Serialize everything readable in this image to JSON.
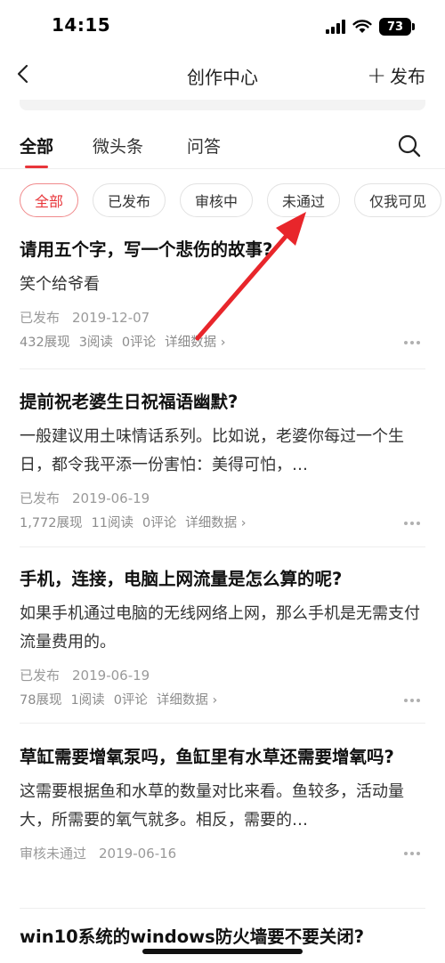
{
  "status_bar": {
    "time": "14:15",
    "battery": "73"
  },
  "nav": {
    "title": "创作中心",
    "publish_label": "发布"
  },
  "tabs": [
    {
      "label": "全部",
      "active": true
    },
    {
      "label": "微头条",
      "active": false
    },
    {
      "label": "问答",
      "active": false
    }
  ],
  "filters": [
    {
      "label": "全部",
      "active": true
    },
    {
      "label": "已发布",
      "active": false
    },
    {
      "label": "审核中",
      "active": false
    },
    {
      "label": "未通过",
      "active": false
    },
    {
      "label": "仅我可见",
      "active": false
    }
  ],
  "articles": [
    {
      "title": "请用五个字，写一个悲伤的故事?",
      "excerpt": "笑个给爷看",
      "status": "已发布",
      "date": "2019-12-07",
      "views": "432展现",
      "reads": "3阅读",
      "comments": "0评论",
      "detail": "详细数据 ›"
    },
    {
      "title": "提前祝老婆生日祝福语幽默?",
      "excerpt": "一般建议用土味情话系列。比如说，老婆你每过一个生日，都令我平添一份害怕：美得可怕，…",
      "status": "已发布",
      "date": "2019-06-19",
      "views": "1,772展现",
      "reads": "11阅读",
      "comments": "0评论",
      "detail": "详细数据 ›"
    },
    {
      "title": "手机，连接，电脑上网流量是怎么算的呢?",
      "excerpt": "如果手机通过电脑的无线网络上网，那么手机是无需支付流量费用的。",
      "status": "已发布",
      "date": "2019-06-19",
      "views": "78展现",
      "reads": "1阅读",
      "comments": "0评论",
      "detail": "详细数据 ›"
    },
    {
      "title": "草缸需要增氧泵吗，鱼缸里有水草还需要增氧吗?",
      "excerpt": "这需要根据鱼和水草的数量对比来看。鱼较多，活动量大，所需要的氧气就多。相反，需要的…",
      "status": "审核未通过",
      "date": "2019-06-16"
    },
    {
      "title": "win10系统的windows防火墙要不要关闭?"
    }
  ],
  "colors": {
    "accent": "#e8353a",
    "annotation_arrow": "#e8262b"
  }
}
